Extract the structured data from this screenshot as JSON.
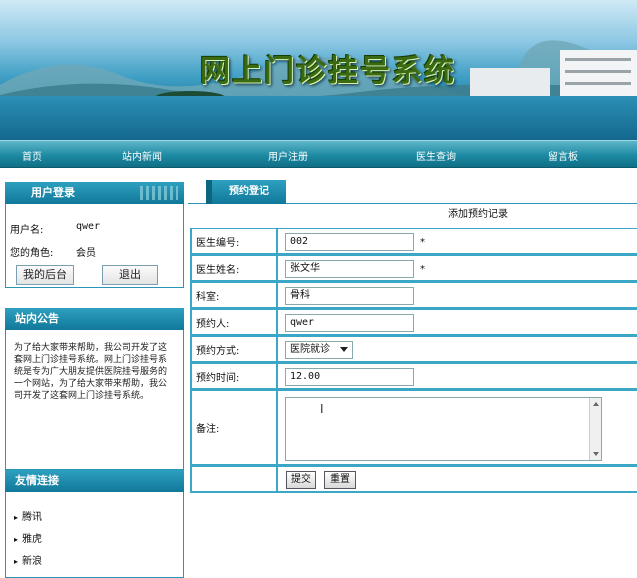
{
  "site": {
    "title": "网上门诊挂号系统"
  },
  "nav": [
    {
      "label": "首页"
    },
    {
      "label": "站内新闻"
    },
    {
      "label": "用户注册"
    },
    {
      "label": "医生查询"
    },
    {
      "label": "留言板"
    }
  ],
  "login": {
    "heading": "用户登录",
    "username_label": "用户名:",
    "username_value": "qwer",
    "role_label": "您的角色:",
    "role_value": "会员",
    "backend_button": "我的后台",
    "logout_button": "退出"
  },
  "notice": {
    "heading": "站内公告",
    "text": "为了给大家带来帮助，我公司开发了这套网上门诊挂号系统。网上门诊挂号系统是专为广大朋友提供医院挂号服务的一个网站，为了给大家带来帮助，我公司开发了这套网上门诊挂号系统。"
  },
  "links": {
    "heading": "友情连接",
    "items": [
      {
        "label": "腾讯"
      },
      {
        "label": "雅虎"
      },
      {
        "label": "新浪"
      }
    ]
  },
  "appointment": {
    "tab_label": "预约登记",
    "form_title": "添加预约记录",
    "fields": {
      "doctor_id": {
        "label": "医生编号:",
        "value": "002",
        "required": "*"
      },
      "doctor_name": {
        "label": "医生姓名:",
        "value": "张文华",
        "required": "*"
      },
      "department": {
        "label": "科室:",
        "value": "骨科"
      },
      "patient": {
        "label": "预约人:",
        "value": "qwer"
      },
      "method": {
        "label": "预约方式:",
        "value": "医院就诊"
      },
      "time": {
        "label": "预约时间:",
        "value": "12.00"
      },
      "remark": {
        "label": "备注:",
        "value": ""
      }
    },
    "submit_button": "提交",
    "reset_button": "重置"
  },
  "colors": {
    "accent": "#1d8aa3",
    "border": "#3aa7c6"
  }
}
